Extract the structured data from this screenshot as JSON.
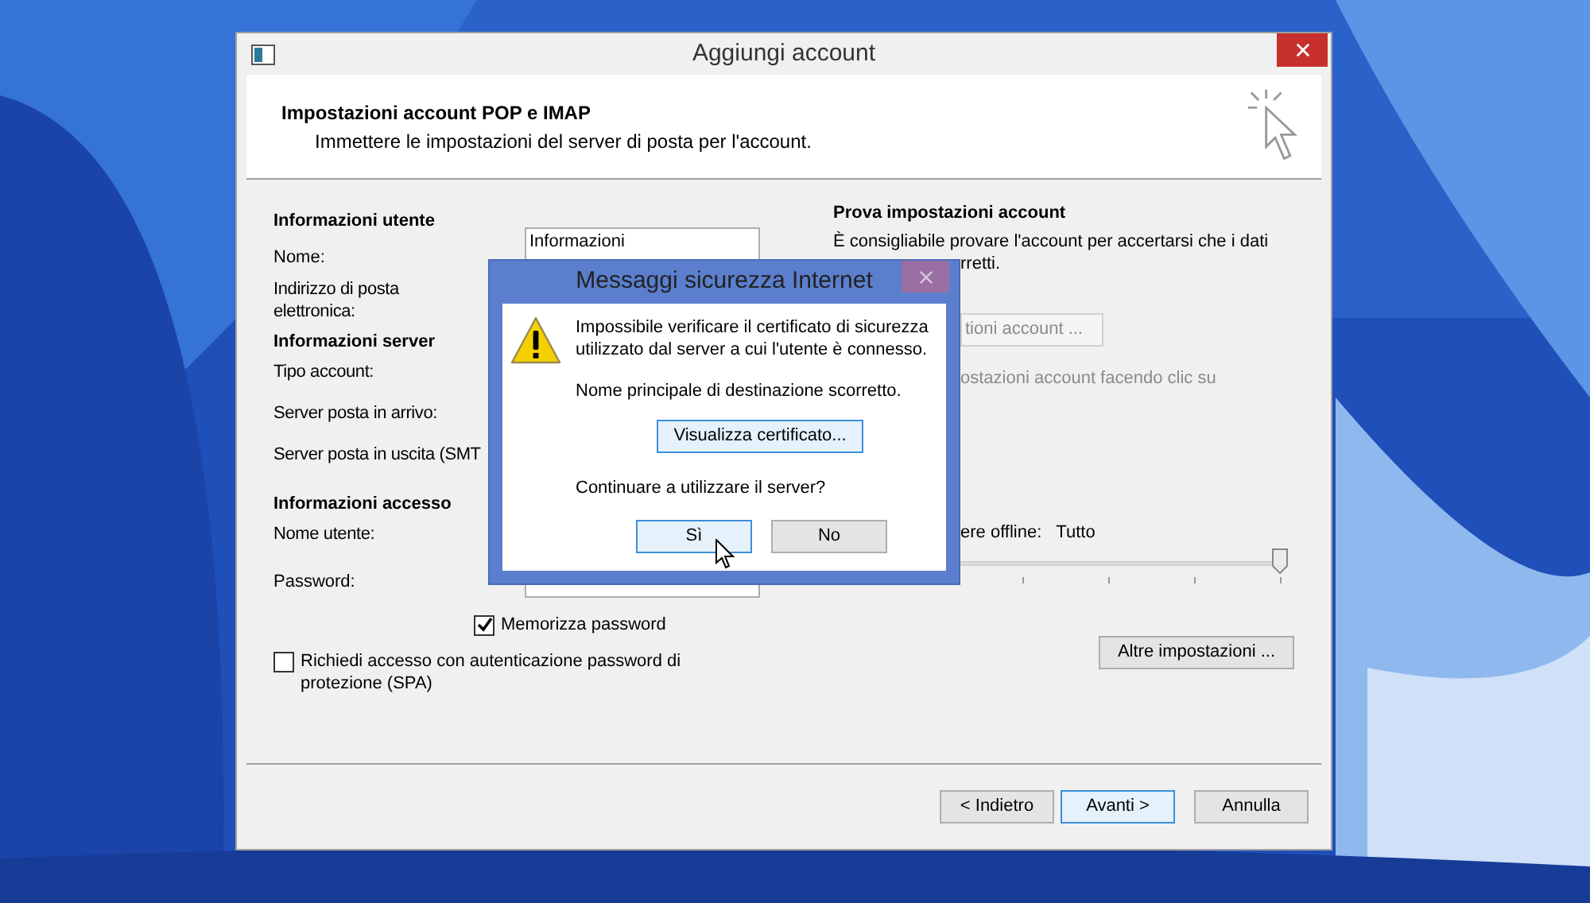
{
  "window": {
    "title": "Aggiungi account"
  },
  "header": {
    "title": "Impostazioni account POP e IMAP",
    "subtitle": "Immettere le impostazioni del server di posta per l'account."
  },
  "left": [
    {
      "kind": "heading",
      "text": "Informazioni utente"
    },
    {
      "kind": "field",
      "label": "Nome:",
      "value": "Informazioni"
    },
    {
      "kind": "label",
      "label": "Indirizzo di posta elettronica:"
    },
    {
      "kind": "heading",
      "text": "Informazioni server"
    },
    {
      "kind": "label",
      "label": "Tipo account:"
    },
    {
      "kind": "label",
      "label": "Server posta in arrivo:"
    },
    {
      "kind": "label",
      "label": "Server posta in uscita (SMT"
    },
    {
      "kind": "heading",
      "text": "Informazioni accesso"
    },
    {
      "kind": "label",
      "label": "Nome utente:"
    },
    {
      "kind": "field",
      "label": "Password:"
    }
  ],
  "remember_password": {
    "label": "Memorizza password",
    "checked": true
  },
  "spa": {
    "label": "Richiedi accesso con autenticazione password di protezione (SPA)",
    "checked": false
  },
  "right": {
    "title": "Prova impostazioni account",
    "description": "È consigliabile provare l'account per accertarsi che i dati",
    "description_tail": "rretti.",
    "test_button": "tioni account ...",
    "test_hint": "ostazioni account facendo clic su",
    "offline_label": "ere offline:",
    "offline_value": "Tutto",
    "slider": {
      "level": 1
    },
    "more_button": "Altre impostazioni ..."
  },
  "buttons": [
    {
      "label": "< Indietro",
      "default": false
    },
    {
      "label": "Avanti >",
      "default": true
    },
    {
      "label": "Annulla",
      "default": false
    }
  ],
  "dialog": {
    "title": "Messaggi sicurezza Internet",
    "message": "Impossibile verificare il certificato di sicurezza utilizzato dal server a cui l'utente è connesso.",
    "detail": "Nome principale di destinazione scorretto.",
    "view_button": "Visualizza certificato...",
    "question": "Continuare a utilizzare il server?",
    "buttons": [
      {
        "label": "Sì",
        "focused": true
      },
      {
        "label": "No",
        "focused": false
      }
    ]
  }
}
